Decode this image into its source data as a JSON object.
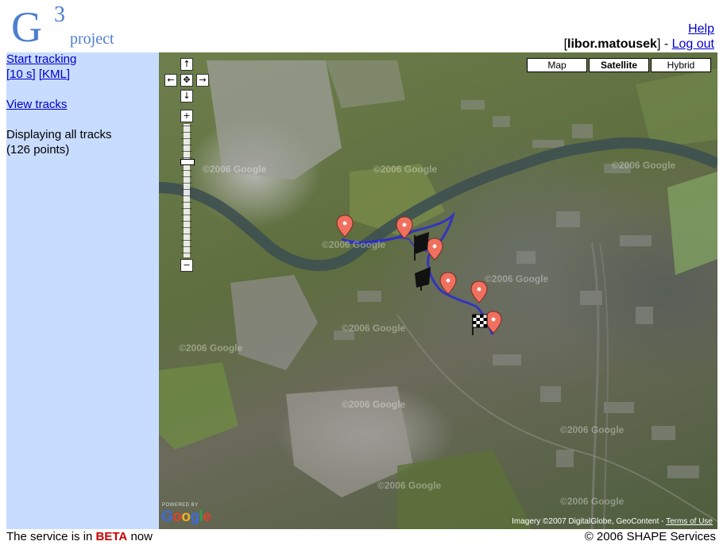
{
  "logo": {
    "letter": "G",
    "superscript": "3",
    "word": "project"
  },
  "header": {
    "help_label": "Help",
    "user_prefix": "[",
    "username": "libor.matousek",
    "separator": "] - ",
    "logout_label": "Log out"
  },
  "sidebar": {
    "start_tracking": "Start tracking",
    "interval": "[10 s]",
    "kml": "[KML]",
    "view_tracks": "View tracks",
    "status_line1": "Displaying all tracks",
    "status_line2": "(126 points)"
  },
  "map": {
    "types": [
      "Map",
      "Satellite",
      "Hybrid"
    ],
    "selected_type": "Satellite",
    "controls": {
      "pan_up": "↑",
      "pan_left": "←",
      "pan_center": "✥",
      "pan_right": "→",
      "pan_down": "↓",
      "zoom_in": "+",
      "zoom_out": "−"
    },
    "watermark": "©2006 Google",
    "power_small": "POWERED BY",
    "power_word": "Google",
    "attribution_text": "Imagery ©2007 DigitalGlobe, GeoContent - ",
    "terms_label": "Terms of Use",
    "track_color": "#2a2ad0",
    "marker_color": "#f07060"
  },
  "footer": {
    "beta_prefix": "The service is in ",
    "beta_word": "BETA",
    "beta_suffix": " now",
    "copyright": "© 2006 SHAPE Services"
  }
}
